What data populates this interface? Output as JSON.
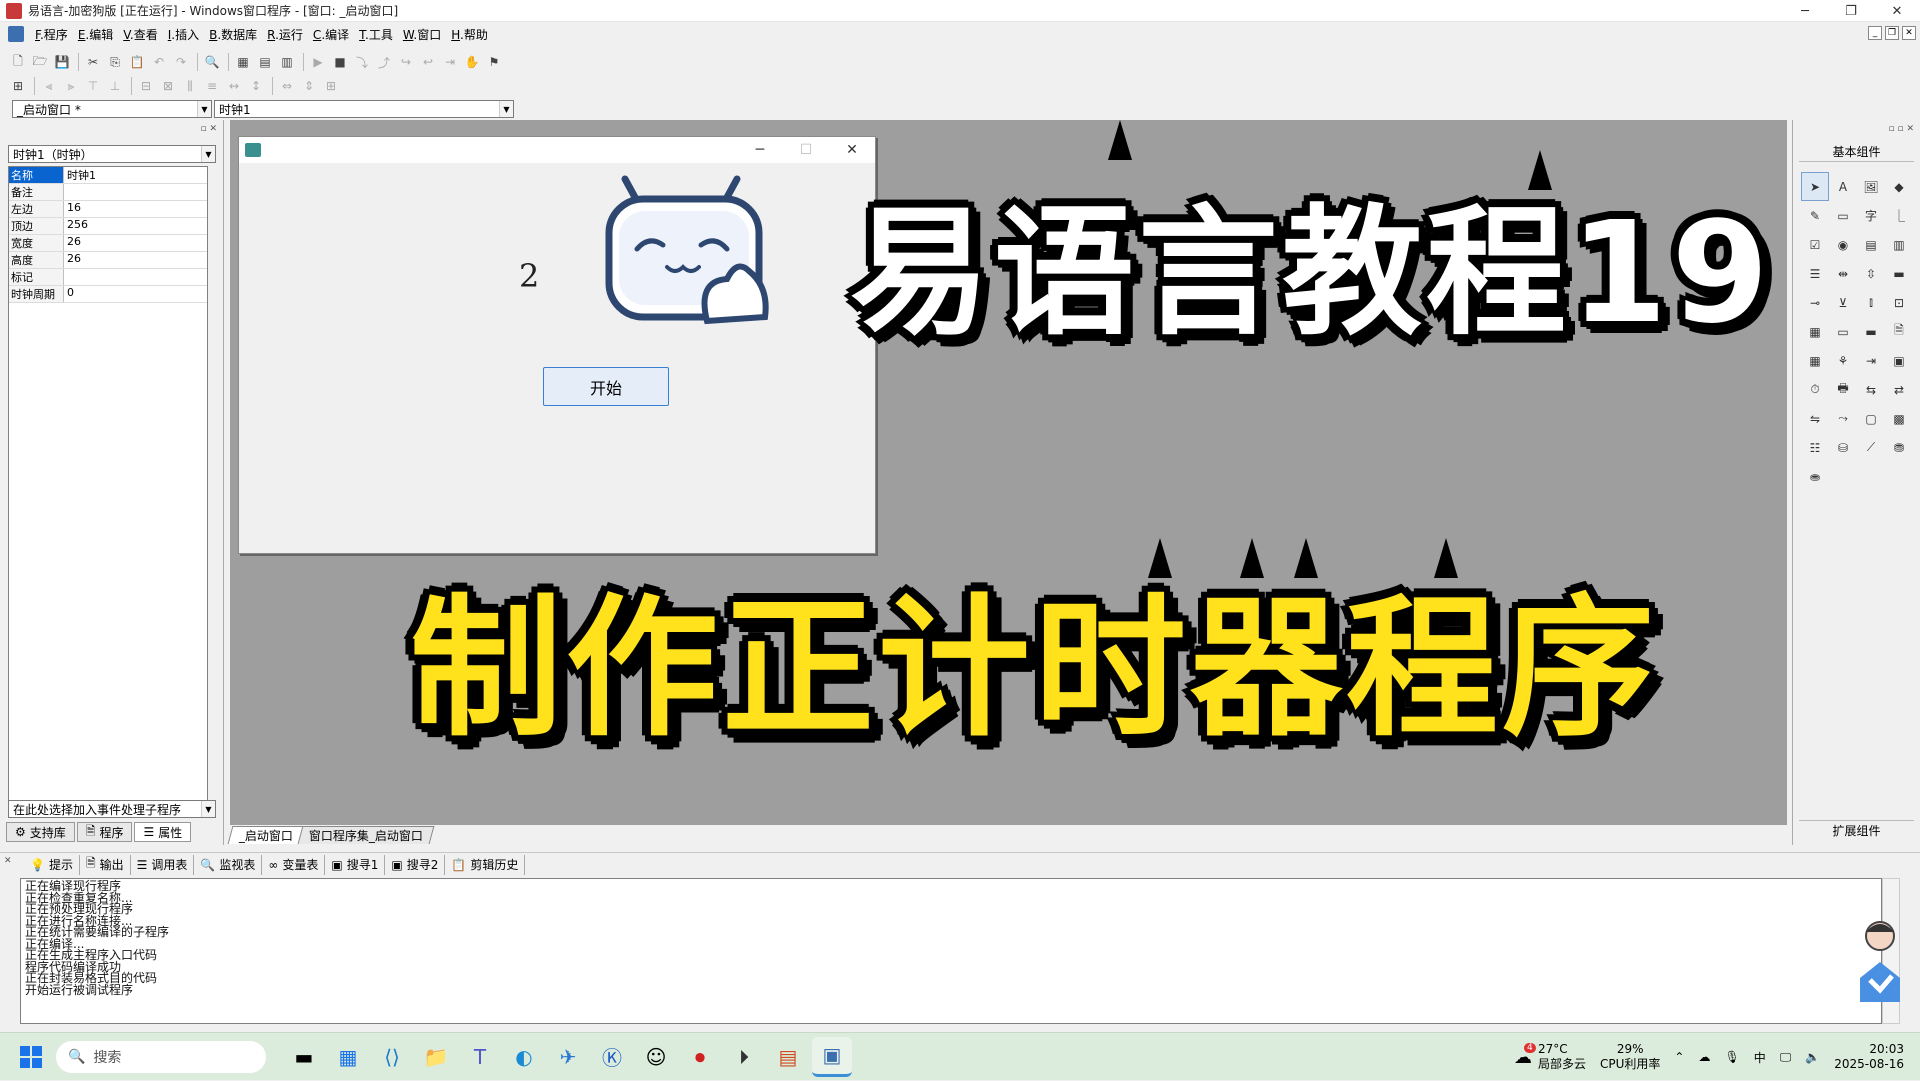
{
  "window": {
    "title": "易语言-加密狗版 [正在运行] - Windows窗口程序 - [窗口: _启动窗口]",
    "controls": {
      "minimize": "─",
      "restore": "❐",
      "close": "✕"
    }
  },
  "menu": [
    {
      "key": "F",
      "label": ".程序"
    },
    {
      "key": "E",
      "label": ".编辑"
    },
    {
      "key": "V",
      "label": ".查看"
    },
    {
      "key": "I",
      "label": ".插入"
    },
    {
      "key": "B",
      "label": ".数据库"
    },
    {
      "key": "R",
      "label": ".运行"
    },
    {
      "key": "C",
      "label": ".编译"
    },
    {
      "key": "T",
      "label": ".工具"
    },
    {
      "key": "W",
      "label": ".窗口"
    },
    {
      "key": "H",
      "label": ".帮助"
    }
  ],
  "combos": {
    "window_select": "_启动窗口 *",
    "component_select": "时钟1"
  },
  "properties": {
    "header": "时钟1（时钟）",
    "rows": [
      {
        "key": "名称",
        "value": "时钟1"
      },
      {
        "key": "备注",
        "value": ""
      },
      {
        "key": "左边",
        "value": "16"
      },
      {
        "key": "顶边",
        "value": "256"
      },
      {
        "key": "宽度",
        "value": "26"
      },
      {
        "key": "高度",
        "value": "26"
      },
      {
        "key": "标记",
        "value": ""
      },
      {
        "key": "时钟周期",
        "value": "0"
      }
    ],
    "event_combo": "在此处选择加入事件处理子程序",
    "tabs": [
      "支持库",
      "程序",
      "属性"
    ]
  },
  "design": {
    "counter": "2",
    "start_button": "开始",
    "headline1": "易语言教程19",
    "headline2": "制作正计时器程序",
    "tabs": [
      "_启动窗口",
      "窗口程序集_启动窗口"
    ]
  },
  "right_panel": {
    "header": "基本组件",
    "footer": "扩展组件"
  },
  "output": {
    "tabs": [
      "提示",
      "输出",
      "调用表",
      "监视表",
      "变量表",
      "搜寻1",
      "搜寻2",
      "剪辑历史"
    ],
    "lines": [
      "正在编译现行程序",
      "正在检查重复名称...",
      "正在预处理现行程序",
      "正在进行名称连接...",
      "正在统计需要编译的子程序",
      "正在编译...",
      "正在生成主程序入口代码",
      "程序代码编译成功",
      "正在封装易格式目的代码",
      "开始运行被调试程序"
    ]
  },
  "taskbar": {
    "search": "搜索",
    "weather_temp": "27°C",
    "weather_desc": "局部多云",
    "weather_badge": "4",
    "cpu_percent": "29%",
    "cpu_label": "CPU利用率",
    "time": "20:03",
    "date": "2025-08-16"
  }
}
